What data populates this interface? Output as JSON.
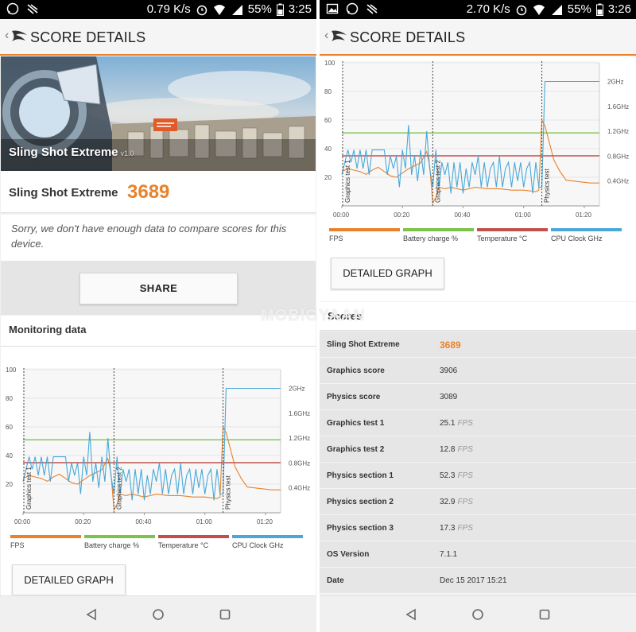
{
  "left": {
    "status": {
      "speed": "0.79 K/s",
      "battery": "55%",
      "time": "3:25"
    },
    "appbar": {
      "title": "SCORE DETAILS"
    },
    "banner": {
      "title": "Sling Shot Extreme",
      "version": "v1.0"
    },
    "score": {
      "name": "Sling Shot Extreme",
      "value": "3689"
    },
    "notice": "Sorry, we don't have enough data to compare scores for this device.",
    "share_label": "SHARE",
    "monitoring_title": "Monitoring data",
    "detail_label": "DETAILED GRAPH"
  },
  "right": {
    "status": {
      "speed": "2.70 K/s",
      "battery": "55%",
      "time": "3:26"
    },
    "appbar": {
      "title": "SCORE DETAILS"
    },
    "detail_label": "DETAILED GRAPH",
    "scores_title": "Scores",
    "scores": [
      {
        "label": "Sling Shot Extreme",
        "value": "3689",
        "unit": ""
      },
      {
        "label": "Graphics score",
        "value": "3906",
        "unit": ""
      },
      {
        "label": "Physics score",
        "value": "3089",
        "unit": ""
      },
      {
        "label": "Graphics test 1",
        "value": "25.1",
        "unit": "FPS"
      },
      {
        "label": "Graphics test 2",
        "value": "12.8",
        "unit": "FPS"
      },
      {
        "label": "Physics section 1",
        "value": "52.3",
        "unit": "FPS"
      },
      {
        "label": "Physics section 2",
        "value": "32.9",
        "unit": "FPS"
      },
      {
        "label": "Physics section 3",
        "value": "17.3",
        "unit": "FPS"
      },
      {
        "label": "OS Version",
        "value": "7.1.1",
        "unit": ""
      },
      {
        "label": "Date",
        "value": "Dec 15 2017 15:21",
        "unit": ""
      }
    ]
  },
  "watermark": "MOBIGYAAN",
  "colors": {
    "accent": "#e8822c",
    "fps": "#e8822c",
    "battery": "#7dc24b",
    "temperature": "#c0504d",
    "cpu": "#4aa8d8"
  },
  "chart_data": {
    "type": "line",
    "x_ticks": [
      "00:00",
      "00:20",
      "00:40",
      "01:00",
      "01:20"
    ],
    "xlim": [
      0,
      85
    ],
    "y_ticks_left": [
      "20",
      "40",
      "60",
      "80",
      "100"
    ],
    "ylim": [
      0,
      100
    ],
    "y_ticks_right": [
      "0.4GHz",
      "0.8GHz",
      "1.2GHz",
      "1.6GHz",
      "2GHz"
    ],
    "y2lim": [
      0,
      2.3
    ],
    "markers": [
      {
        "label": "Graphics test 1",
        "x": 0
      },
      {
        "label": "Graphics test 2",
        "x": 30
      },
      {
        "label": "Physics test",
        "x": 66
      }
    ],
    "series": [
      {
        "name": "FPS",
        "axis": "left",
        "x": [
          0,
          2,
          4,
          6,
          8,
          10,
          12,
          14,
          16,
          18,
          20,
          22,
          24,
          26,
          28,
          29,
          30,
          31,
          32,
          34,
          36,
          40,
          44,
          48,
          52,
          56,
          60,
          64,
          65,
          66,
          67,
          68,
          70,
          72,
          74,
          78,
          82,
          85
        ],
        "y": [
          24,
          26,
          25,
          24,
          22,
          25,
          27,
          24,
          21,
          20,
          23,
          26,
          28,
          30,
          38,
          28,
          2,
          6,
          13,
          12,
          13,
          11,
          13,
          12,
          12,
          11,
          11,
          10,
          11,
          60,
          56,
          48,
          32,
          24,
          18,
          17,
          16,
          16
        ]
      },
      {
        "name": "Battery charge %",
        "axis": "left",
        "x": [
          0,
          85
        ],
        "y": [
          51,
          51
        ]
      },
      {
        "name": "Temperature °C",
        "axis": "left",
        "x": [
          0,
          85
        ],
        "y": [
          35,
          35
        ]
      },
      {
        "name": "CPU Clock GHz",
        "axis": "right",
        "x": [
          0,
          1,
          2,
          3,
          4,
          5,
          6,
          7,
          8,
          9,
          10,
          12,
          14,
          15,
          16,
          17,
          18,
          19,
          20,
          21,
          22,
          23,
          24,
          25,
          26,
          27,
          28,
          29,
          30,
          31,
          32,
          33,
          34,
          35,
          36,
          37,
          38,
          39,
          40,
          41,
          42,
          43,
          44,
          45,
          46,
          47,
          48,
          49,
          50,
          51,
          52,
          53,
          54,
          55,
          56,
          57,
          58,
          59,
          60,
          61,
          62,
          63,
          64,
          65,
          66,
          67,
          68,
          85
        ],
        "y": [
          0.5,
          0.7,
          0.9,
          0.7,
          0.9,
          0.6,
          0.9,
          0.6,
          0.9,
          0.5,
          0.9,
          0.9,
          0.9,
          0.5,
          0.8,
          0.6,
          0.8,
          0.3,
          0.9,
          0.6,
          1.3,
          0.5,
          0.8,
          0.4,
          0.9,
          0.5,
          1.2,
          0.6,
          0.3,
          0.9,
          0.3,
          0.7,
          0.5,
          0.7,
          0.2,
          0.7,
          0.3,
          0.7,
          0.2,
          0.6,
          0.3,
          0.7,
          0.5,
          0.8,
          0.3,
          0.7,
          0.3,
          0.6,
          0.7,
          0.3,
          0.8,
          0.3,
          0.6,
          0.7,
          0.3,
          0.7,
          0.4,
          0.7,
          0.3,
          0.6,
          0.7,
          0.2,
          0.7,
          0.3,
          0.3,
          2.0,
          2.0,
          2.0
        ]
      }
    ]
  }
}
